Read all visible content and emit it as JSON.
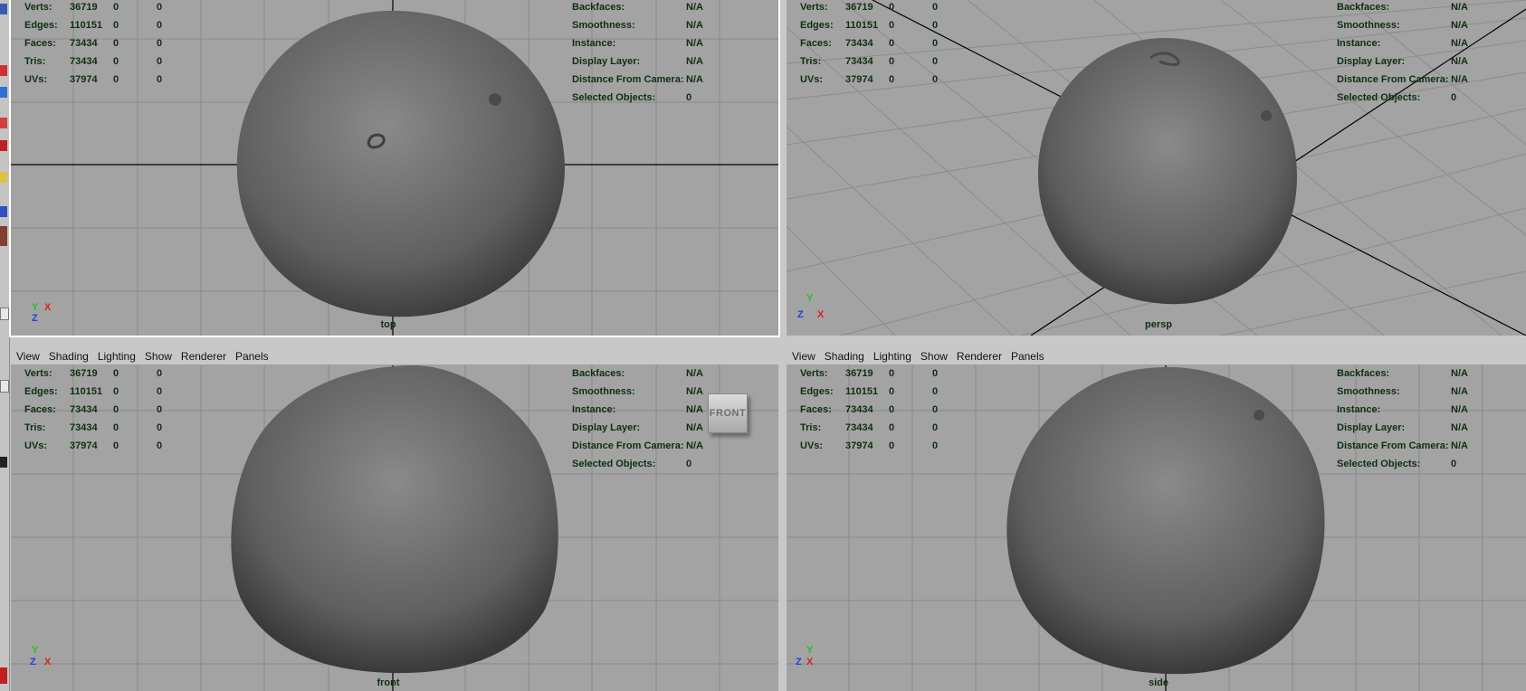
{
  "menu": [
    "View",
    "Shading",
    "Lighting",
    "Show",
    "Renderer",
    "Panels"
  ],
  "hud_left": [
    {
      "label": "Verts:",
      "v1": "36719",
      "v2": "0",
      "v3": "0"
    },
    {
      "label": "Edges:",
      "v1": "110151",
      "v2": "0",
      "v3": "0"
    },
    {
      "label": "Faces:",
      "v1": "73434",
      "v2": "0",
      "v3": "0"
    },
    {
      "label": "Tris:",
      "v1": "73434",
      "v2": "0",
      "v3": "0"
    },
    {
      "label": "UVs:",
      "v1": "37974",
      "v2": "0",
      "v3": "0"
    }
  ],
  "hud_right": [
    {
      "label": "Backfaces:",
      "value": "N/A"
    },
    {
      "label": "Smoothness:",
      "value": "N/A"
    },
    {
      "label": "Instance:",
      "value": "N/A"
    },
    {
      "label": "Display Layer:",
      "value": "N/A"
    },
    {
      "label": "Distance From Camera:",
      "value": "N/A"
    },
    {
      "label": "Selected Objects:",
      "value": "0"
    }
  ],
  "cameras": {
    "top": "top",
    "persp": "persp",
    "front": "front",
    "side": "side"
  },
  "viewcube": {
    "front_label": "FRONT"
  },
  "axes": {
    "x": "X",
    "y": "Y",
    "z": "Z"
  },
  "colors": {
    "viewport_bg": "#a3a3a3",
    "grid": "#8a8a8a",
    "axis_line": "#000000",
    "hud_text": "#0e2f10",
    "axis_x": "#e02020",
    "axis_y": "#20c020",
    "axis_z": "#2040e0"
  }
}
